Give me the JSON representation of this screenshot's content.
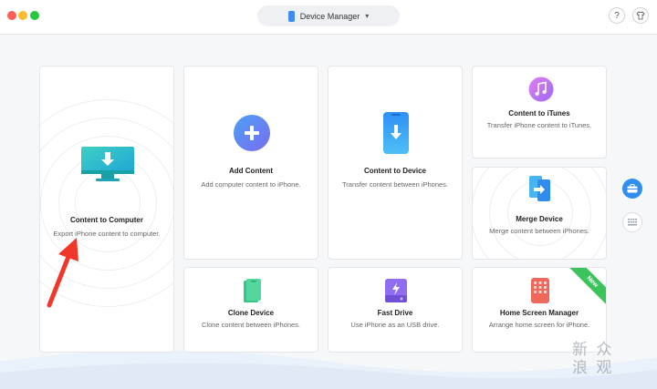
{
  "titlebar": {
    "device_selector_label": "Device Manager",
    "help_label": "?"
  },
  "cards": {
    "content_to_computer": {
      "title": "Content to Computer",
      "desc": "Export iPhone content to computer."
    },
    "add_content": {
      "title": "Add Content",
      "desc": "Add computer content to iPhone."
    },
    "content_to_device": {
      "title": "Content to Device",
      "desc": "Transfer content between iPhones."
    },
    "content_to_itunes": {
      "title": "Content to iTunes",
      "desc": "Transfer iPhone content to iTunes."
    },
    "merge_device": {
      "title": "Merge Device",
      "desc": "Merge content between iPhones."
    },
    "clone_device": {
      "title": "Clone Device",
      "desc": "Clone content between iPhones."
    },
    "fast_drive": {
      "title": "Fast Drive",
      "desc": "Use iPhone as an USB drive."
    },
    "home_screen_manager": {
      "title": "Home Screen Manager",
      "desc": "Arrange home screen for iPhone.",
      "badge": "New"
    }
  },
  "watermark": "新 众\n浪 观",
  "colors": {
    "accent_blue": "#2f8ef0",
    "arrow_red": "#f0372a",
    "badge_green": "#3cc45c"
  }
}
